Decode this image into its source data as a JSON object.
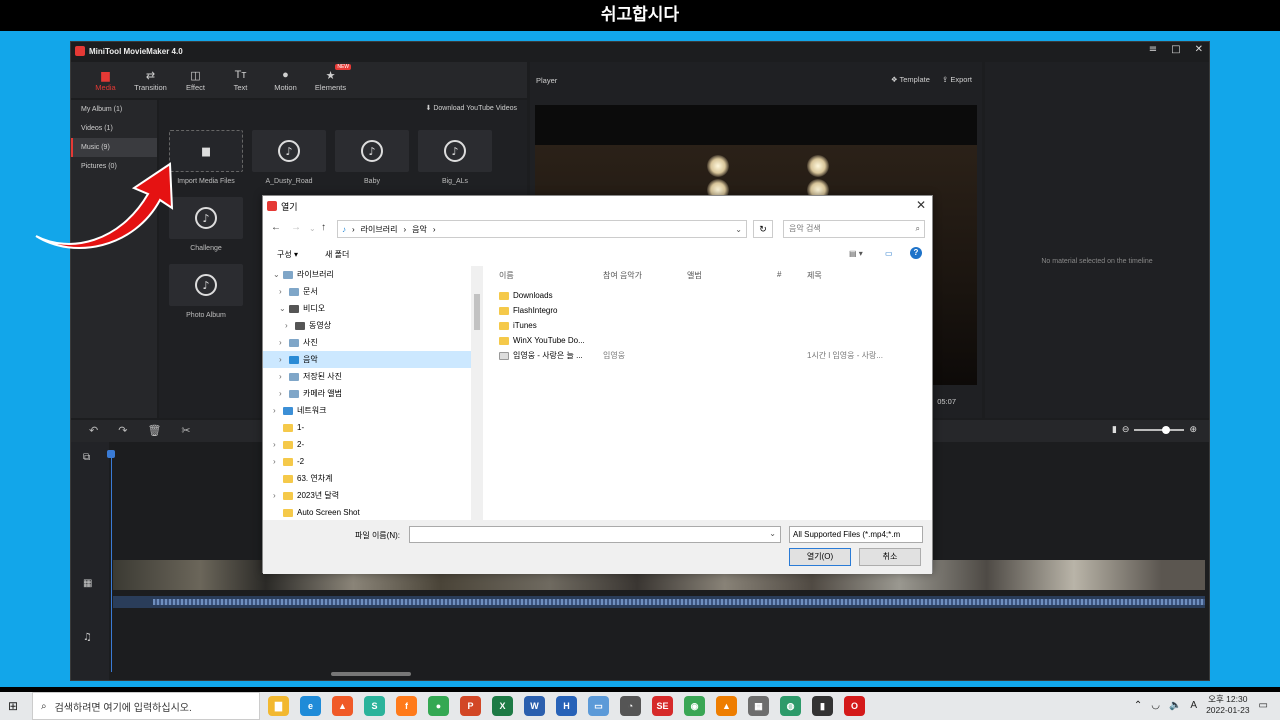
{
  "overlay_title": "쉬고합시다",
  "app": {
    "title": "MiniTool MovieMaker 4.0",
    "window_controls": [
      "≡",
      "□",
      "✕"
    ],
    "toolbar": [
      {
        "label": "Media",
        "icon": "folder-icon",
        "active": true
      },
      {
        "label": "Transition",
        "icon": "transition-icon"
      },
      {
        "label": "Effect",
        "icon": "effect-icon"
      },
      {
        "label": "Text",
        "icon": "text-icon"
      },
      {
        "label": "Motion",
        "icon": "motion-icon"
      },
      {
        "label": "Elements",
        "icon": "elements-icon",
        "badge": "NEW"
      }
    ],
    "sidebar": [
      {
        "label": "My Album (1)"
      },
      {
        "label": "Videos (1)"
      },
      {
        "label": "Music (9)",
        "active": true
      },
      {
        "label": "Pictures (0)"
      }
    ],
    "download_youtube": "Download YouTube Videos",
    "media_tiles": [
      {
        "label": "Import Media Files"
      },
      {
        "label": "A_Dusty_Road"
      },
      {
        "label": "Baby"
      },
      {
        "label": "Big_ALs"
      },
      {
        "label": "Challenge"
      },
      {
        "label": "Photo Album"
      }
    ],
    "player": {
      "label": "Player",
      "template": "Template",
      "export": "Export",
      "time": "05:07"
    },
    "properties": {
      "empty_text": "No material selected on the timeline"
    }
  },
  "dialog": {
    "title": "열기",
    "breadcrumb": [
      "라이브러리",
      "음악"
    ],
    "search_placeholder": "음악 검색",
    "cmd_organize": "구성 ▾",
    "cmd_new_folder": "새 폴더",
    "tree": [
      {
        "label": "라이브러리",
        "depth": 0,
        "type": "lib",
        "chev": "⌄"
      },
      {
        "label": "문서",
        "depth": 1,
        "type": "lib",
        "chev": "›"
      },
      {
        "label": "비디오",
        "depth": 1,
        "type": "lib",
        "chev": "⌄"
      },
      {
        "label": "동영상",
        "depth": 2,
        "type": "lib",
        "chev": "›"
      },
      {
        "label": "사진",
        "depth": 1,
        "type": "lib",
        "chev": "›"
      },
      {
        "label": "음악",
        "depth": 1,
        "type": "music",
        "chev": "›",
        "selected": true
      },
      {
        "label": "저장된 사진",
        "depth": 1,
        "type": "lib",
        "chev": "›"
      },
      {
        "label": "카메라 앨범",
        "depth": 1,
        "type": "lib",
        "chev": "›"
      },
      {
        "label": "네트워크",
        "depth": 0,
        "type": "lib",
        "chev": "›"
      },
      {
        "label": "1-",
        "depth": 0,
        "type": "folder",
        "chev": ""
      },
      {
        "label": "2-",
        "depth": 0,
        "type": "folder",
        "chev": "›"
      },
      {
        "label": "-2",
        "depth": 0,
        "type": "folder",
        "chev": "›"
      },
      {
        "label": "63. 연차계",
        "depth": 0,
        "type": "folder",
        "chev": ""
      },
      {
        "label": "2023년 달력",
        "depth": 0,
        "type": "folder",
        "chev": "›"
      },
      {
        "label": "Auto Screen Shot",
        "depth": 0,
        "type": "folder",
        "chev": ""
      }
    ],
    "columns": [
      "이름",
      "참여 음악가",
      "앨범",
      "#",
      "제목"
    ],
    "files": [
      {
        "name": "Downloads",
        "artist": "",
        "title": ""
      },
      {
        "name": "FlashIntegro",
        "artist": "",
        "title": ""
      },
      {
        "name": "iTunes",
        "artist": "",
        "title": ""
      },
      {
        "name": "WinX YouTube Do...",
        "artist": "",
        "title": ""
      },
      {
        "name": "임영웅 - 사랑은 늘 ...",
        "artist": "임영웅",
        "title": "1시간 l 임영웅 - 사랑..."
      }
    ],
    "filename_label": "파일 이름(N):",
    "filename_value": "",
    "filter": "All Supported Files (*.mp4;*.m",
    "open_button": "열기(O)",
    "cancel_button": "취소"
  },
  "taskbar": {
    "search_placeholder": "검색하려면 여기에 입력하십시오.",
    "apps": [
      {
        "name": "explorer",
        "color": "#f2b830",
        "glyph": "▇"
      },
      {
        "name": "edge",
        "color": "#1f8bd8",
        "glyph": "e"
      },
      {
        "name": "brave",
        "color": "#f05a28",
        "glyph": "▲"
      },
      {
        "name": "app-teal",
        "color": "#2bb39b",
        "glyph": "S"
      },
      {
        "name": "firefox",
        "color": "#ff7a1a",
        "glyph": "f"
      },
      {
        "name": "chrome",
        "color": "#34a853",
        "glyph": "●"
      },
      {
        "name": "powerpoint",
        "color": "#d24726",
        "glyph": "P"
      },
      {
        "name": "excel",
        "color": "#1d7a45",
        "glyph": "X"
      },
      {
        "name": "word",
        "color": "#2b5fae",
        "glyph": "W"
      },
      {
        "name": "app-blue",
        "color": "#2762b8",
        "glyph": "H"
      },
      {
        "name": "app-monitor",
        "color": "#5c9ad8",
        "glyph": "▭"
      },
      {
        "name": "app-circle",
        "color": "#555",
        "glyph": "◔"
      },
      {
        "name": "app-red",
        "color": "#d62a2a",
        "glyph": "SE"
      },
      {
        "name": "app-green",
        "color": "#3aa655",
        "glyph": "◉"
      },
      {
        "name": "vlc",
        "color": "#ee7d00",
        "glyph": "▲"
      },
      {
        "name": "calculator",
        "color": "#6d6d6d",
        "glyph": "▦"
      },
      {
        "name": "app-globe",
        "color": "#2d9a6a",
        "glyph": "◍"
      },
      {
        "name": "app-notes",
        "color": "#333",
        "glyph": "▮"
      },
      {
        "name": "opera",
        "color": "#d41a1a",
        "glyph": "O"
      }
    ],
    "tray_lang": "A",
    "clock_ampm_time": "오후 12:30",
    "clock_date": "2022-01-23"
  }
}
